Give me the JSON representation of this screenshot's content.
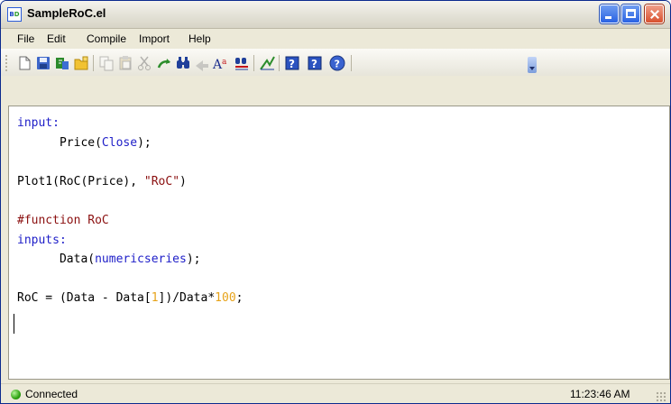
{
  "window": {
    "title": "SampleRoC.el",
    "icon_name": "app-icon"
  },
  "menu": {
    "items": [
      "File",
      "Edit",
      "Compile",
      "Import",
      "Help"
    ]
  },
  "toolbar": {
    "icons": [
      "new-document-icon",
      "save-icon",
      "open-icon",
      "folder-icon",
      "copy-icon",
      "paste-icon",
      "cut-icon",
      "undo-icon",
      "find-icon",
      "find-next-icon",
      "font-icon",
      "replace-icon",
      "plot-icon",
      "help-icon",
      "context-help-icon",
      "about-icon",
      "toolbar-options-icon"
    ]
  },
  "editor": {
    "lines": [
      "input:",
      "      Price(Close);",
      "",
      "Plot1(RoC(Price), \"RoC\")",
      "",
      "#function RoC",
      "inputs:",
      "      Data(numericseries);",
      "",
      "RoC = (Data - Data[1])/Data*100;"
    ],
    "colors": {
      "keyword": "#1e1ec8",
      "number": "#e7a31a",
      "string": "#8b1010",
      "comment": "#8b1010"
    }
  },
  "status": {
    "connection": "Connected",
    "time": "11:23:46 AM"
  }
}
